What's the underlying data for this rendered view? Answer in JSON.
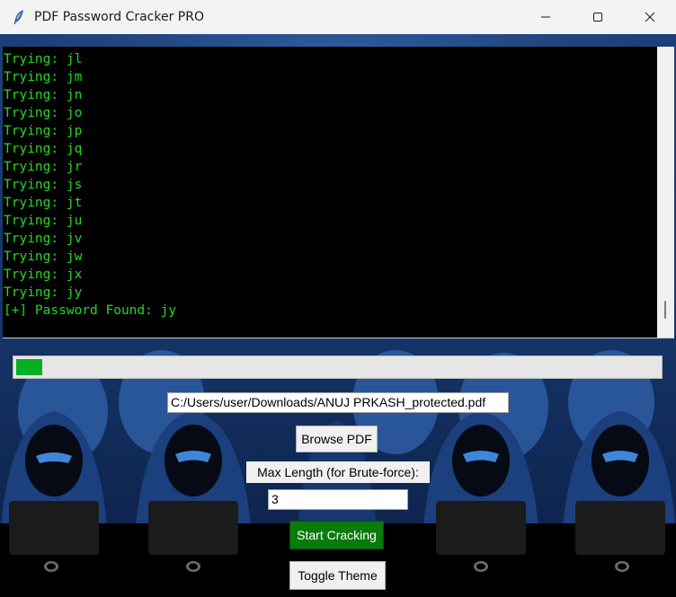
{
  "window": {
    "title": "PDF Password Cracker PRO",
    "icon": "feather-icon",
    "controls": [
      "minimize-icon",
      "maximize-icon",
      "close-icon"
    ]
  },
  "console": {
    "text_color": "#25d825",
    "background": "#000000",
    "lines": [
      "Trying: jl",
      "Trying: jm",
      "Trying: jn",
      "Trying: jo",
      "Trying: jp",
      "Trying: jq",
      "Trying: jr",
      "Trying: js",
      "Trying: jt",
      "Trying: ju",
      "Trying: jv",
      "Trying: jw",
      "Trying: jx",
      "Trying: jy",
      "[+] Password Found: jy"
    ]
  },
  "progress": {
    "fraction": 0.04,
    "color": "#06b025"
  },
  "file": {
    "path": "C:/Users/user/Downloads/ANUJ PRKASH_protected.pdf"
  },
  "buttons": {
    "browse": "Browse PDF",
    "start": "Start Cracking",
    "toggle_theme": "Toggle Theme"
  },
  "max_length": {
    "label": "Max Length (for Brute-force):",
    "value": "3"
  },
  "colors": {
    "accent_start": "#0a7a0a",
    "background_scene": "#1a3a6e"
  }
}
